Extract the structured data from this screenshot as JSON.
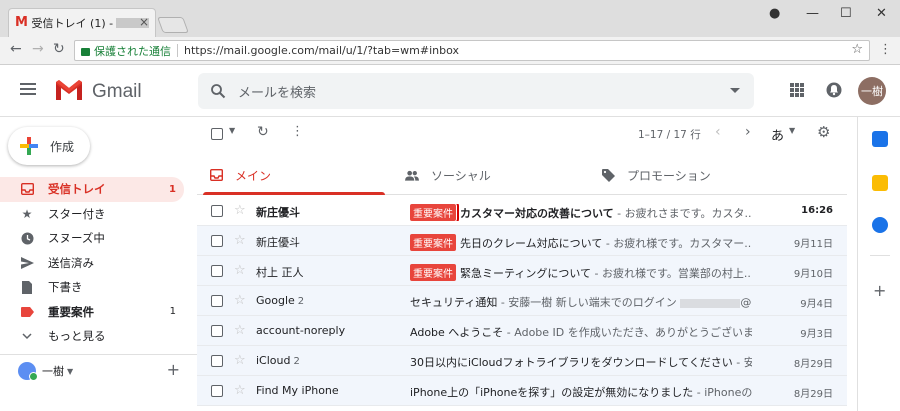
{
  "browser": {
    "tab_title": "受信トレイ (1) -",
    "tab_close": "×",
    "window_controls": [
      "●",
      "—",
      "☐",
      "✕"
    ],
    "back": "←",
    "forward": "→",
    "reload": "↻",
    "secure_label": "保護された通信",
    "url": "https://mail.google.com/mail/u/1/?tab=wm#inbox",
    "bookmark_star": "☆",
    "menu": "⋮"
  },
  "header": {
    "app_name": "Gmail",
    "search_placeholder": "メールを検索",
    "avatar_initials": "一樹"
  },
  "sidebar": {
    "compose_label": "作成",
    "items": [
      {
        "label": "受信トレイ",
        "count": "1",
        "icon": "inbox-icon"
      },
      {
        "label": "スター付き",
        "count": "",
        "icon": "star-icon"
      },
      {
        "label": "スヌーズ中",
        "count": "",
        "icon": "clock-icon"
      },
      {
        "label": "送信済み",
        "count": "",
        "icon": "send-icon"
      },
      {
        "label": "下書き",
        "count": "",
        "icon": "draft-icon"
      },
      {
        "label": "重要案件",
        "count": "1",
        "icon": "label-icon"
      },
      {
        "label": "もっと見る",
        "count": "",
        "icon": "chevron-down-icon"
      }
    ],
    "user_name": "一樹"
  },
  "toolbar": {
    "range": "1–17 / 17 行",
    "ime": "あ"
  },
  "tabs": [
    {
      "label": "メイン"
    },
    {
      "label": "ソーシャル"
    },
    {
      "label": "プロモーション"
    }
  ],
  "emails": [
    {
      "sender": "新庄優斗",
      "count": "",
      "label": "重要案件",
      "subject": "カスタマー対応の改善について",
      "snippet": " - お疲れさまです。カスタ...",
      "date": "16:26"
    },
    {
      "sender": "新庄優斗",
      "count": "",
      "label": "重要案件",
      "subject": "先日のクレーム対応について",
      "snippet": " - お疲れ様です。カスタマー...",
      "date": "9月11日"
    },
    {
      "sender": "村上 正人",
      "count": "",
      "label": "重要案件",
      "subject": "緊急ミーティングについて",
      "snippet": " - お疲れ様です。営業部の村上...",
      "date": "9月10日"
    },
    {
      "sender": "Google",
      "count": "2",
      "label": "",
      "subject": "セキュリティ通知",
      "snippet": " - 安藤一樹 新しい端末でのログイン",
      "snippet_tail": "@...",
      "date": "9月4日"
    },
    {
      "sender": "account-noreply",
      "count": "",
      "label": "",
      "subject": "Adobe へようこそ",
      "snippet": " - Adobe ID を作成いただき、ありがとうございま...",
      "date": "9月3日"
    },
    {
      "sender": "iCloud",
      "count": "2",
      "label": "",
      "subject": "30日以内にiCloudフォトライブラリをダウンロードしてください",
      "snippet": " - 安...",
      "date": "8月29日"
    },
    {
      "sender": "Find My iPhone",
      "count": "",
      "label": "",
      "subject": "iPhone上の「iPhoneを探す」の設定が無効になりました",
      "snippet": " - iPhoneの「...",
      "date": "8月29日"
    }
  ]
}
